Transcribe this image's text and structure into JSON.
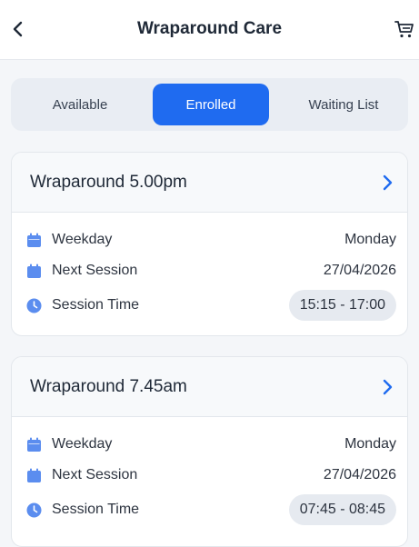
{
  "header": {
    "title": "Wraparound Care"
  },
  "tabs": [
    {
      "label": "Available"
    },
    {
      "label": "Enrolled"
    },
    {
      "label": "Waiting List"
    }
  ],
  "cards": [
    {
      "title": "Wraparound 5.00pm",
      "weekday_label": "Weekday",
      "weekday_value": "Monday",
      "next_label": "Next Session",
      "next_value": "27/04/2026",
      "time_label": "Session Time",
      "time_value": "15:15 - 17:00"
    },
    {
      "title": "Wraparound 7.45am",
      "weekday_label": "Weekday",
      "weekday_value": "Monday",
      "next_label": "Next Session",
      "next_value": "27/04/2026",
      "time_label": "Session Time",
      "time_value": "07:45 - 08:45"
    }
  ],
  "colors": {
    "accent": "#1f6bf0",
    "icon": "#5b8def",
    "pill_bg": "#e6eaf0"
  },
  "icons": {
    "back": "chevron-left-icon",
    "cart": "cart-icon",
    "card_chevron": "chevron-right-icon",
    "weekday": "calendar-icon",
    "next_session": "calendar-icon",
    "session_time": "clock-icon"
  }
}
